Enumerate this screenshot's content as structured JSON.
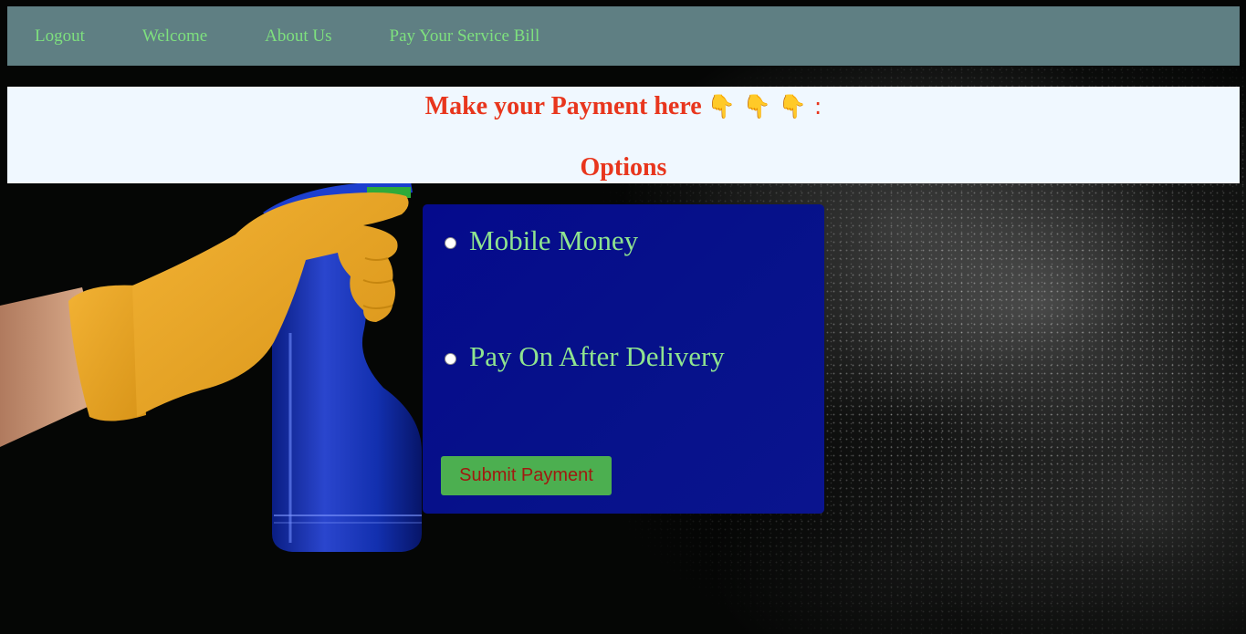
{
  "nav": {
    "links": [
      {
        "label": "Logout"
      },
      {
        "label": "Welcome"
      },
      {
        "label": "About Us"
      },
      {
        "label": "Pay Your Service Bill"
      }
    ]
  },
  "header": {
    "title": "Make your Payment here",
    "pointers": "👇 👇 👇 :",
    "options_heading": "Options"
  },
  "payment": {
    "options": [
      {
        "label": "Mobile Money",
        "selected": false
      },
      {
        "label": "Pay On After Delivery",
        "selected": false
      }
    ],
    "submit_label": "Submit Payment"
  },
  "colors": {
    "navbar": "#5f7f83",
    "nav_text": "#7ee07e",
    "header_bg": "#f0f8ff",
    "header_text": "#e8361d",
    "panel_bg": "#050a8c",
    "option_text": "#8fe48f",
    "button_bg": "#4caf50",
    "button_text": "#a01a10"
  },
  "background": {
    "image": "hand-in-yellow-glove-holding-blue-spray-bottle"
  }
}
